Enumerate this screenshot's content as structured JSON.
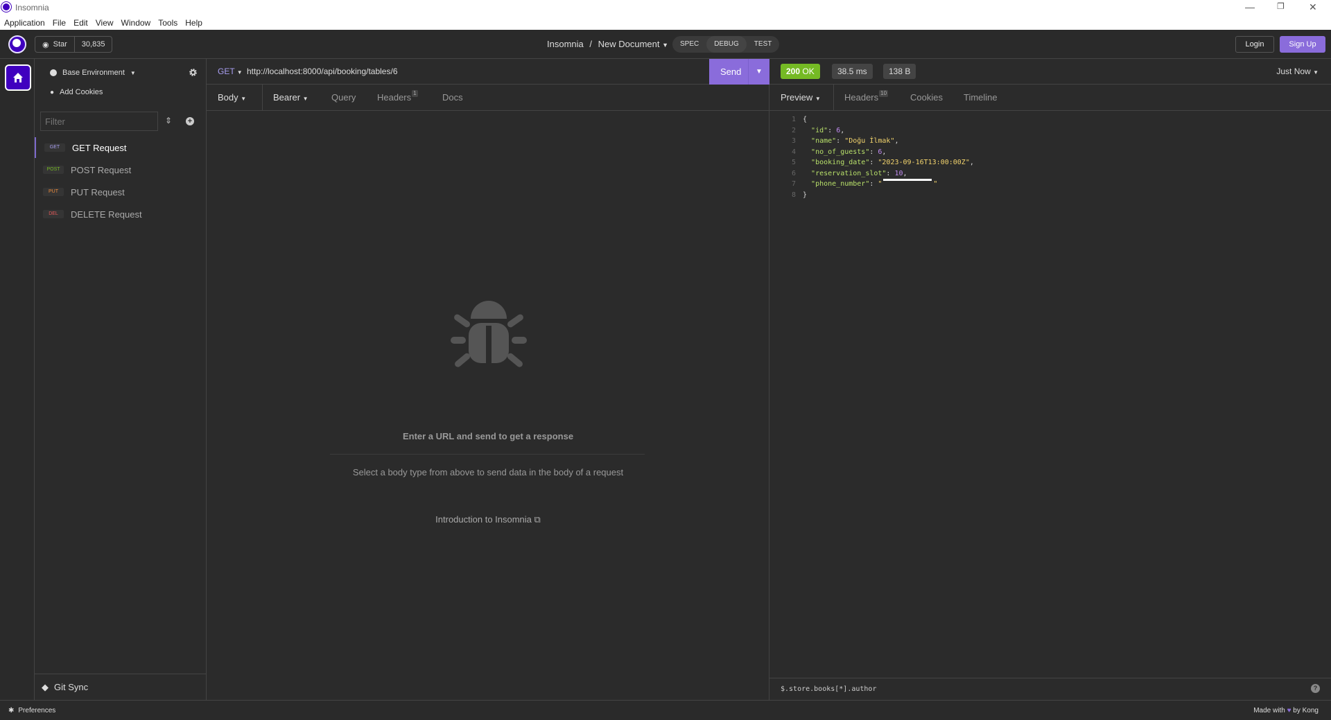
{
  "window": {
    "title": "Insomnia"
  },
  "menu": [
    "Application",
    "File",
    "Edit",
    "View",
    "Window",
    "Tools",
    "Help"
  ],
  "header": {
    "star_label": "Star",
    "star_count": "30,835",
    "breadcrumb_app": "Insomnia",
    "breadcrumb_sep": "/",
    "breadcrumb_doc": "New Document",
    "modes": [
      "SPEC",
      "DEBUG",
      "TEST"
    ],
    "active_mode": "DEBUG",
    "login": "Login",
    "signup": "Sign Up"
  },
  "sidebar": {
    "environment": "Base Environment",
    "cookies": "Add Cookies",
    "filter_placeholder": "Filter",
    "requests": [
      {
        "method": "GET",
        "label": "GET Request",
        "color": "#a99ff2"
      },
      {
        "method": "POST",
        "label": "POST Request",
        "color": "#75ba24"
      },
      {
        "method": "PUT",
        "label": "PUT Request",
        "color": "#f08c3c"
      },
      {
        "method": "DEL",
        "label": "DELETE Request",
        "color": "#e65a5a"
      }
    ],
    "git_sync": "Git Sync"
  },
  "request": {
    "method": "GET",
    "url": "http://localhost:8000/api/booking/tables/6",
    "send": "Send",
    "tabs": {
      "body": "Body",
      "auth": "Bearer",
      "query": "Query",
      "headers": "Headers",
      "headers_count": "1",
      "docs": "Docs"
    },
    "empty_title": "Enter a URL and send to get a response",
    "empty_sub": "Select a body type from above to send data in the body of a request",
    "intro_link": "Introduction to Insomnia"
  },
  "response": {
    "status_code": "200",
    "status_text": "OK",
    "time": "38.5 ms",
    "size": "138 B",
    "timestamp": "Just Now",
    "tabs": {
      "preview": "Preview",
      "headers": "Headers",
      "headers_count": "10",
      "cookies": "Cookies",
      "timeline": "Timeline"
    },
    "json": {
      "l1": "{",
      "id_key": "\"id\"",
      "id_val": "6",
      "name_key": "\"name\"",
      "name_val": "\"Doğu İlmak\"",
      "guests_key": "\"no_of_guests\"",
      "guests_val": "6",
      "date_key": "\"booking_date\"",
      "date_val": "\"2023-09-16T13:00:00Z\"",
      "slot_key": "\"reservation_slot\"",
      "slot_val": "10",
      "phone_key": "\"phone_number\"",
      "l8": "}"
    },
    "filter": "$.store.books[*].author"
  },
  "footer": {
    "preferences": "Preferences",
    "made_with": "Made with",
    "by": "by Kong"
  }
}
